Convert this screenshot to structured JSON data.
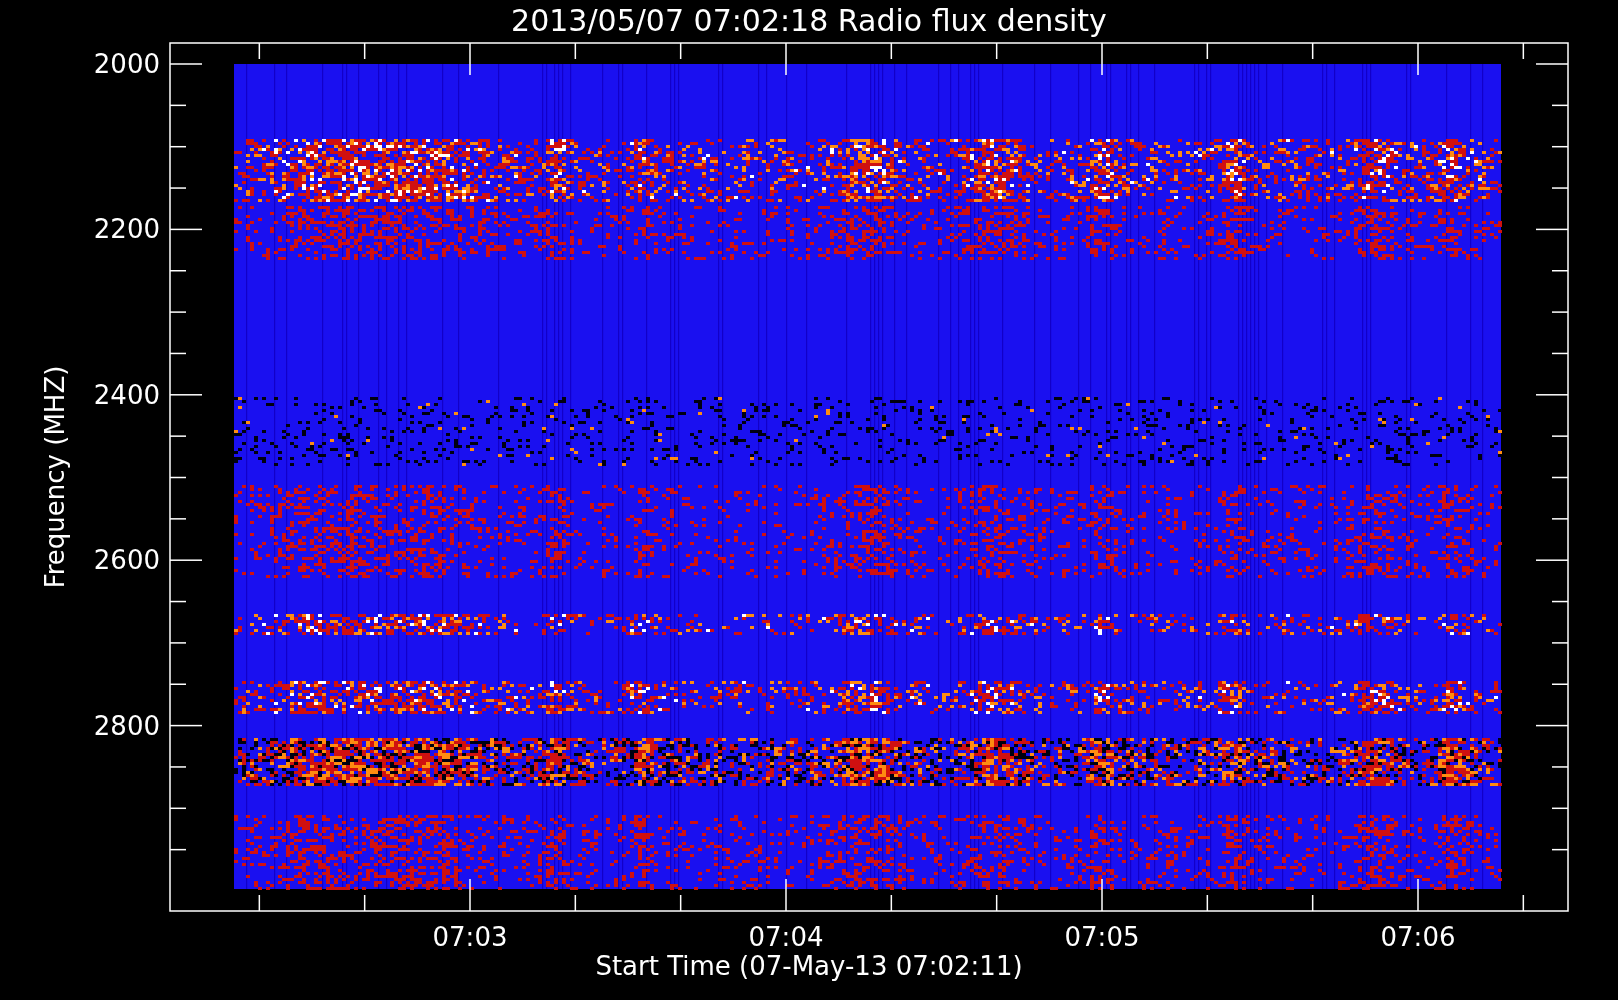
{
  "title": "2013/05/07 07:02:18 Radio flux density",
  "y_axis": {
    "label": "Frequency (MHZ)",
    "ticks": [
      "2000",
      "2200",
      "2400",
      "2600",
      "2800"
    ]
  },
  "x_axis": {
    "label": "Start Time (07-May-13 07:02:11)",
    "ticks": [
      "07:03",
      "07:04",
      "07:05",
      "07:06"
    ]
  }
}
